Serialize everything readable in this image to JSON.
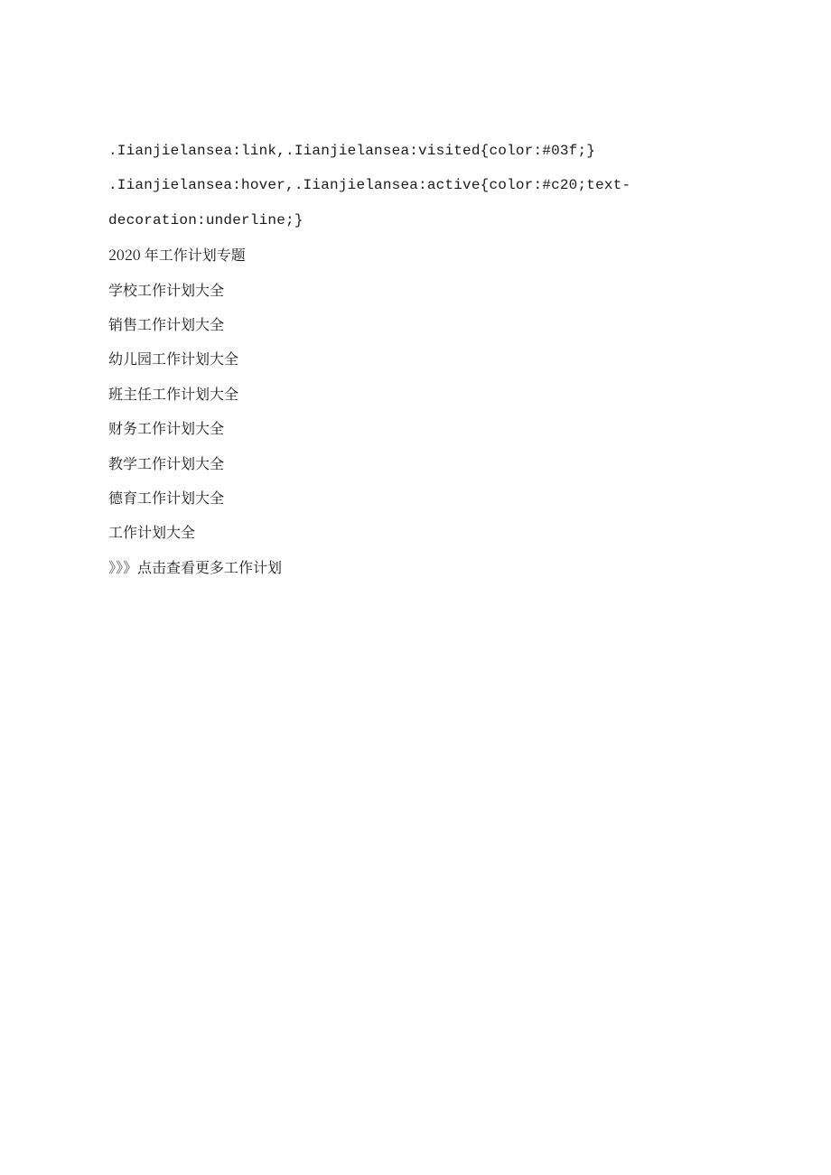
{
  "lines": [
    ".Iianjielansea:link,.Iianjielansea:visited{color:#03f;}",
    ".Iianjielansea:hover,.Iianjielansea:active{color:#c20;text-",
    "decoration:underline;}",
    "2020 年工作计划专题",
    "学校工作计划大全",
    "销售工作计划大全",
    "幼儿园工作计划大全",
    "班主任工作计划大全",
    "财务工作计划大全",
    "教学工作计划大全",
    "德育工作计划大全",
    "工作计划大全",
    "》》》点击查看更多工作计划"
  ]
}
